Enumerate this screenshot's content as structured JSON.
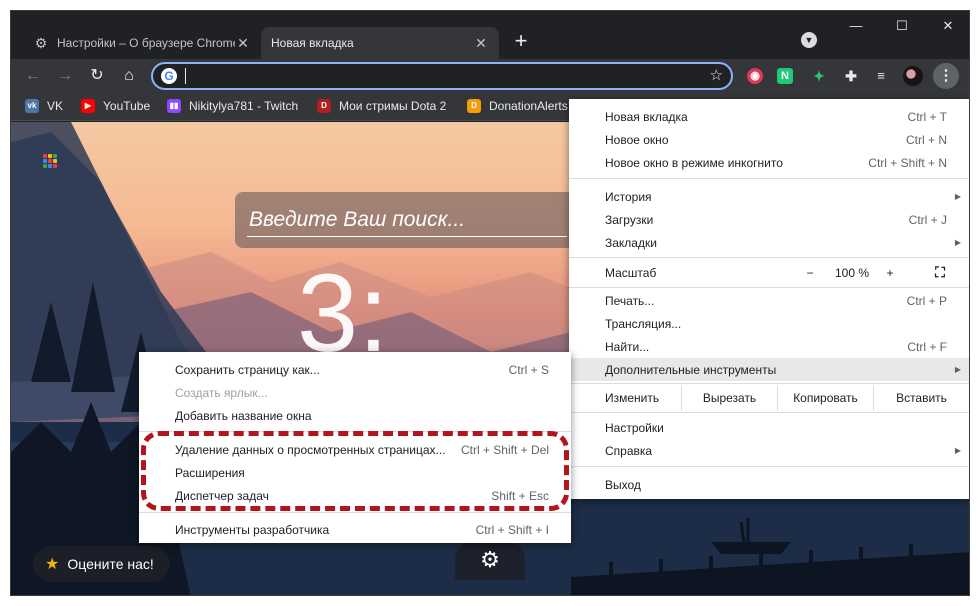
{
  "tabs": [
    {
      "title": "Настройки – О браузере Chrome",
      "icon": "gear-icon"
    },
    {
      "title": "Новая вкладка"
    }
  ],
  "window": {
    "minimize": "—",
    "maximize": "☐",
    "close": "✕"
  },
  "toolbar": {
    "back": "←",
    "forward": "→",
    "reload": "↻",
    "home": "⌂",
    "star": "☆",
    "menu": "⋮"
  },
  "omnibox": {
    "value": ""
  },
  "bookmarks": [
    {
      "label": "VK",
      "color": "#4a76a8",
      "icon": "vk-icon"
    },
    {
      "label": "YouTube",
      "color": "#ff0000",
      "icon": "youtube-icon"
    },
    {
      "label": "Nikitylya781 - Twitch",
      "color": "#9146ff",
      "icon": "twitch-icon"
    },
    {
      "label": "Мои стримы Dota 2",
      "color": "#b01e1e",
      "icon": "dota-icon"
    },
    {
      "label": "DonationAlerts",
      "color": "#f59c07",
      "icon": "donationalerts-icon"
    }
  ],
  "newtab": {
    "search_placeholder": "Введите Ваш поиск...",
    "clock": "3:",
    "rate_label": "Оцените нас!"
  },
  "chrome_menu": {
    "items_top": [
      {
        "label": "Новая вкладка",
        "shortcut": "Ctrl + T"
      },
      {
        "label": "Новое окно",
        "shortcut": "Ctrl + N"
      },
      {
        "label": "Новое окно в режиме инкогнито",
        "shortcut": "Ctrl + Shift + N"
      }
    ],
    "history": {
      "label": "История"
    },
    "downloads": {
      "label": "Загрузки",
      "shortcut": "Ctrl + J"
    },
    "bookmarks": {
      "label": "Закладки"
    },
    "zoom": {
      "label": "Масштаб",
      "minus": "−",
      "value": "100 %",
      "plus": "+"
    },
    "print": {
      "label": "Печать...",
      "shortcut": "Ctrl + P"
    },
    "cast": {
      "label": "Трансляция..."
    },
    "find": {
      "label": "Найти...",
      "shortcut": "Ctrl + F"
    },
    "more_tools": {
      "label": "Дополнительные инструменты"
    },
    "edit": {
      "label": "Изменить",
      "cut": "Вырезать",
      "copy": "Копировать",
      "paste": "Вставить"
    },
    "settings": {
      "label": "Настройки"
    },
    "help": {
      "label": "Справка"
    },
    "exit": {
      "label": "Выход"
    }
  },
  "more_tools_menu": [
    {
      "label": "Сохранить страницу как...",
      "shortcut": "Ctrl + S"
    },
    {
      "label": "Создать ярлык...",
      "shortcut": ""
    },
    {
      "label": "Добавить название окна",
      "shortcut": ""
    },
    {
      "label": "Удаление данных о просмотренных страницах...",
      "shortcut": "Ctrl + Shift + Del"
    },
    {
      "label": "Расширения",
      "shortcut": ""
    },
    {
      "label": "Диспетчер задач",
      "shortcut": "Shift + Esc"
    },
    {
      "label": "Инструменты разработчика",
      "shortcut": "Ctrl + Shift + I"
    }
  ],
  "colors": {
    "highlight": "#b3151b",
    "accent": "#8ab4f8"
  }
}
